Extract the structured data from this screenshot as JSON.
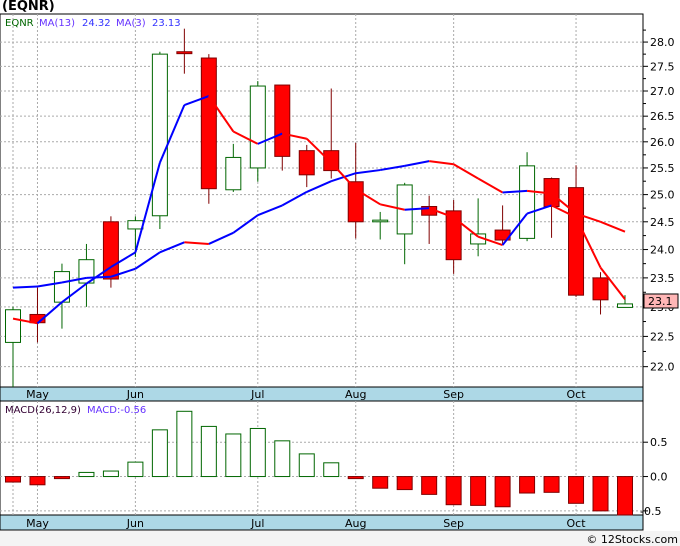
{
  "title": "(EQNR)",
  "footer": "© 12Stocks.com",
  "colors": {
    "up": "#006600",
    "down": "#ff0000",
    "down_border": "#800000",
    "ma_up": "#0000ff",
    "ma_down": "#ff0000",
    "axis_strip": "#add8e6",
    "last_price_bg": "#ffb6b6"
  },
  "chart_data": [
    {
      "type": "candlestick",
      "legend": {
        "symbol": "EQNR",
        "ma13_label": "MA(13)",
        "ma13_value": "24.32",
        "ma3_label": "MA(3)",
        "ma3_value": "23.13"
      },
      "scale": "log",
      "ylim": [
        21.67,
        28.59
      ],
      "yticks": [
        "22.0",
        "22.5",
        "23.0",
        "23.5",
        "24.0",
        "24.5",
        "25.0",
        "25.5",
        "26.0",
        "26.5",
        "27.0",
        "27.5",
        "28.0"
      ],
      "last_price_label": "23.1",
      "grid": true,
      "months": [
        {
          "label": "May",
          "index": 1
        },
        {
          "label": "Jun",
          "index": 5
        },
        {
          "label": "Jul",
          "index": 10
        },
        {
          "label": "Aug",
          "index": 14
        },
        {
          "label": "Sep",
          "index": 18
        },
        {
          "label": "Oct",
          "index": 23
        }
      ],
      "ohlc": [
        [
          22.4,
          23.0,
          21.6,
          22.95
        ],
        [
          22.87,
          23.33,
          22.4,
          22.73
        ],
        [
          23.08,
          23.75,
          22.63,
          23.61
        ],
        [
          23.41,
          24.1,
          23.0,
          23.82
        ],
        [
          24.5,
          24.6,
          23.33,
          23.48
        ],
        [
          24.37,
          24.6,
          23.87,
          24.52
        ],
        [
          24.61,
          27.8,
          24.37,
          27.75
        ],
        [
          27.8,
          28.28,
          27.35,
          27.76
        ],
        [
          27.67,
          27.75,
          24.83,
          25.11
        ],
        [
          25.09,
          25.96,
          25.05,
          25.7
        ],
        [
          25.5,
          27.2,
          25.24,
          27.1
        ],
        [
          27.12,
          27.12,
          25.45,
          25.72
        ],
        [
          25.83,
          25.94,
          25.14,
          25.37
        ],
        [
          25.83,
          27.05,
          25.3,
          25.45
        ],
        [
          25.24,
          25.98,
          24.2,
          24.5
        ],
        [
          24.5,
          24.68,
          24.18,
          24.53
        ],
        [
          24.28,
          25.22,
          23.74,
          25.18
        ],
        [
          24.78,
          24.98,
          24.1,
          24.62
        ],
        [
          24.7,
          24.9,
          23.57,
          23.82
        ],
        [
          24.1,
          24.93,
          23.88,
          24.28
        ],
        [
          24.35,
          24.8,
          24.08,
          24.17
        ],
        [
          24.2,
          25.8,
          24.15,
          25.54
        ],
        [
          25.3,
          25.32,
          24.21,
          24.78
        ],
        [
          25.13,
          25.55,
          23.17,
          23.2
        ],
        [
          23.5,
          23.6,
          22.87,
          23.12
        ],
        [
          22.99,
          23.2,
          22.99,
          23.05
        ]
      ],
      "ma13": [
        23.33,
        23.35,
        23.42,
        23.5,
        23.52,
        23.66,
        23.95,
        24.13,
        24.1,
        24.3,
        24.62,
        24.8,
        25.05,
        25.25,
        25.4,
        25.46,
        25.54,
        25.63,
        25.57,
        25.3,
        25.04,
        25.07,
        25.02,
        24.65,
        24.5,
        24.32
      ],
      "ma3": [
        22.8,
        22.72,
        23.08,
        23.4,
        23.69,
        23.95,
        25.6,
        26.72,
        26.9,
        26.2,
        25.96,
        26.16,
        26.06,
        25.6,
        25.1,
        24.82,
        24.72,
        24.75,
        24.58,
        24.23,
        24.08,
        24.65,
        24.8,
        24.58,
        23.68,
        23.13
      ]
    },
    {
      "type": "bar",
      "legend": {
        "label": "MACD(26,12,9)",
        "value_label": "MACD:-0.56"
      },
      "ylim": [
        -0.56,
        1.1
      ],
      "yticks": [
        "-0.5",
        "0.0",
        "0.5"
      ],
      "values": [
        -0.08,
        -0.12,
        -0.03,
        0.06,
        0.08,
        0.21,
        0.68,
        0.95,
        0.73,
        0.62,
        0.7,
        0.52,
        0.33,
        0.2,
        -0.03,
        -0.17,
        -0.19,
        -0.26,
        -0.41,
        -0.42,
        -0.44,
        -0.24,
        -0.23,
        -0.39,
        -0.5,
        -0.56
      ]
    }
  ]
}
